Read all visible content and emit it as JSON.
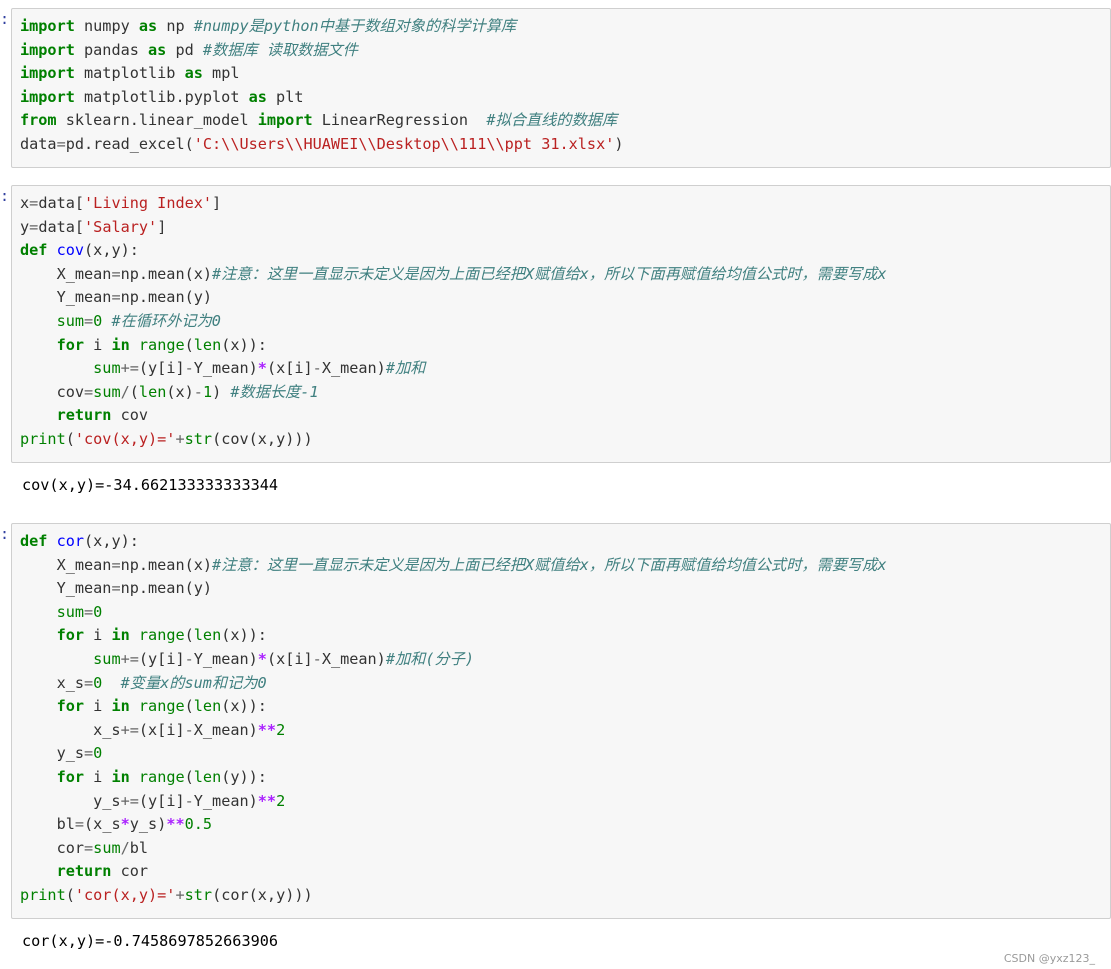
{
  "cells": [
    {
      "prompt": ":",
      "lines": [
        [
          [
            "kw",
            "import"
          ],
          [
            "t",
            " numpy "
          ],
          [
            "kw",
            "as"
          ],
          [
            "t",
            " np "
          ],
          [
            "cm",
            "#numpy是python中基于数组对象的科学计算库"
          ]
        ],
        [
          [
            "kw",
            "import"
          ],
          [
            "t",
            " pandas "
          ],
          [
            "kw",
            "as"
          ],
          [
            "t",
            " pd "
          ],
          [
            "cm",
            "#数据库 读取数据文件"
          ]
        ],
        [
          [
            "kw",
            "import"
          ],
          [
            "t",
            " matplotlib "
          ],
          [
            "kw",
            "as"
          ],
          [
            "t",
            " mpl"
          ]
        ],
        [
          [
            "kw",
            "import"
          ],
          [
            "t",
            " matplotlib.pyplot "
          ],
          [
            "kw",
            "as"
          ],
          [
            "t",
            " plt"
          ]
        ],
        [
          [
            "kw",
            "from"
          ],
          [
            "t",
            " sklearn.linear_model "
          ],
          [
            "kw",
            "import"
          ],
          [
            "t",
            " LinearRegression  "
          ],
          [
            "cm",
            "#拟合直线的数据库"
          ]
        ],
        [
          [
            "t",
            "data"
          ],
          [
            "op",
            "="
          ],
          [
            "t",
            "pd.read_excel("
          ],
          [
            "str",
            "'C:\\\\Users\\\\HUAWEI\\\\Desktop\\\\111\\\\ppt 31.xlsx'"
          ],
          [
            "t",
            ")"
          ]
        ]
      ]
    },
    {
      "prompt": ":",
      "lines": [
        [
          [
            "t",
            "x"
          ],
          [
            "op",
            "="
          ],
          [
            "t",
            "data["
          ],
          [
            "str",
            "'Living Index'"
          ],
          [
            "t",
            "]"
          ]
        ],
        [
          [
            "t",
            "y"
          ],
          [
            "op",
            "="
          ],
          [
            "t",
            "data["
          ],
          [
            "str",
            "'Salary'"
          ],
          [
            "t",
            "]"
          ]
        ],
        [
          [
            "kw",
            "def"
          ],
          [
            "t",
            " "
          ],
          [
            "fn",
            "cov"
          ],
          [
            "t",
            "(x,y):"
          ]
        ],
        [
          [
            "t",
            "    X_mean"
          ],
          [
            "op",
            "="
          ],
          [
            "t",
            "np.mean(x)"
          ],
          [
            "cm",
            "#注意：这里一直显示未定义是因为上面已经把X赋值给x，所以下面再赋值给均值公式时，需要写成x"
          ]
        ],
        [
          [
            "t",
            "    Y_mean"
          ],
          [
            "op",
            "="
          ],
          [
            "t",
            "np.mean(y)"
          ]
        ],
        [
          [
            "t",
            "    "
          ],
          [
            "bi",
            "sum"
          ],
          [
            "op",
            "="
          ],
          [
            "num",
            "0"
          ],
          [
            "t",
            " "
          ],
          [
            "cm",
            "#在循环外记为0"
          ]
        ],
        [
          [
            "t",
            "    "
          ],
          [
            "kw",
            "for"
          ],
          [
            "t",
            " i "
          ],
          [
            "kw",
            "in"
          ],
          [
            "t",
            " "
          ],
          [
            "bi",
            "range"
          ],
          [
            "t",
            "("
          ],
          [
            "bi",
            "len"
          ],
          [
            "t",
            "(x)):"
          ]
        ],
        [
          [
            "t",
            "        "
          ],
          [
            "bi",
            "sum"
          ],
          [
            "op",
            "+="
          ],
          [
            "t",
            "(y[i]"
          ],
          [
            "op",
            "-"
          ],
          [
            "t",
            "Y_mean)"
          ],
          [
            "opw",
            "*"
          ],
          [
            "t",
            "(x[i]"
          ],
          [
            "op",
            "-"
          ],
          [
            "t",
            "X_mean)"
          ],
          [
            "cm",
            "#加和"
          ]
        ],
        [
          [
            "t",
            "    cov"
          ],
          [
            "op",
            "="
          ],
          [
            "bi",
            "sum"
          ],
          [
            "op",
            "/"
          ],
          [
            "t",
            "("
          ],
          [
            "bi",
            "len"
          ],
          [
            "t",
            "(x)"
          ],
          [
            "op",
            "-"
          ],
          [
            "num",
            "1"
          ],
          [
            "t",
            ") "
          ],
          [
            "cm",
            "#数据长度-1"
          ]
        ],
        [
          [
            "t",
            "    "
          ],
          [
            "kw",
            "return"
          ],
          [
            "t",
            " cov"
          ]
        ],
        [
          [
            "bi",
            "print"
          ],
          [
            "t",
            "("
          ],
          [
            "str",
            "'cov(x,y)='"
          ],
          [
            "op",
            "+"
          ],
          [
            "bi",
            "str"
          ],
          [
            "t",
            "(cov(x,y)))"
          ]
        ]
      ],
      "output": "cov(x,y)=-34.662133333333344"
    },
    {
      "prompt": ":",
      "lines": [
        [
          [
            "kw",
            "def"
          ],
          [
            "t",
            " "
          ],
          [
            "fn",
            "cor"
          ],
          [
            "t",
            "(x,y):"
          ]
        ],
        [
          [
            "t",
            "    X_mean"
          ],
          [
            "op",
            "="
          ],
          [
            "t",
            "np.mean(x)"
          ],
          [
            "cm",
            "#注意：这里一直显示未定义是因为上面已经把X赋值给x，所以下面再赋值给均值公式时，需要写成x"
          ]
        ],
        [
          [
            "t",
            "    Y_mean"
          ],
          [
            "op",
            "="
          ],
          [
            "t",
            "np.mean(y)"
          ]
        ],
        [
          [
            "t",
            "    "
          ],
          [
            "bi",
            "sum"
          ],
          [
            "op",
            "="
          ],
          [
            "num",
            "0"
          ]
        ],
        [
          [
            "t",
            "    "
          ],
          [
            "kw",
            "for"
          ],
          [
            "t",
            " i "
          ],
          [
            "kw",
            "in"
          ],
          [
            "t",
            " "
          ],
          [
            "bi",
            "range"
          ],
          [
            "t",
            "("
          ],
          [
            "bi",
            "len"
          ],
          [
            "t",
            "(x)):"
          ]
        ],
        [
          [
            "t",
            "        "
          ],
          [
            "bi",
            "sum"
          ],
          [
            "op",
            "+="
          ],
          [
            "t",
            "(y[i]"
          ],
          [
            "op",
            "-"
          ],
          [
            "t",
            "Y_mean)"
          ],
          [
            "opw",
            "*"
          ],
          [
            "t",
            "(x[i]"
          ],
          [
            "op",
            "-"
          ],
          [
            "t",
            "X_mean)"
          ],
          [
            "cm",
            "#加和(分子)"
          ]
        ],
        [
          [
            "t",
            "    x_s"
          ],
          [
            "op",
            "="
          ],
          [
            "num",
            "0"
          ],
          [
            "t",
            "  "
          ],
          [
            "cm",
            "#变量x的sum和记为0"
          ]
        ],
        [
          [
            "t",
            "    "
          ],
          [
            "kw",
            "for"
          ],
          [
            "t",
            " i "
          ],
          [
            "kw",
            "in"
          ],
          [
            "t",
            " "
          ],
          [
            "bi",
            "range"
          ],
          [
            "t",
            "("
          ],
          [
            "bi",
            "len"
          ],
          [
            "t",
            "(x)):"
          ]
        ],
        [
          [
            "t",
            "        x_s"
          ],
          [
            "op",
            "+="
          ],
          [
            "t",
            "(x[i]"
          ],
          [
            "op",
            "-"
          ],
          [
            "t",
            "X_mean)"
          ],
          [
            "opw",
            "**"
          ],
          [
            "num",
            "2"
          ]
        ],
        [
          [
            "t",
            "    y_s"
          ],
          [
            "op",
            "="
          ],
          [
            "num",
            "0"
          ]
        ],
        [
          [
            "t",
            "    "
          ],
          [
            "kw",
            "for"
          ],
          [
            "t",
            " i "
          ],
          [
            "kw",
            "in"
          ],
          [
            "t",
            " "
          ],
          [
            "bi",
            "range"
          ],
          [
            "t",
            "("
          ],
          [
            "bi",
            "len"
          ],
          [
            "t",
            "(y)):"
          ]
        ],
        [
          [
            "t",
            "        y_s"
          ],
          [
            "op",
            "+="
          ],
          [
            "t",
            "(y[i]"
          ],
          [
            "op",
            "-"
          ],
          [
            "t",
            "Y_mean)"
          ],
          [
            "opw",
            "**"
          ],
          [
            "num",
            "2"
          ]
        ],
        [
          [
            "t",
            "    bl"
          ],
          [
            "op",
            "="
          ],
          [
            "t",
            "(x_s"
          ],
          [
            "opw",
            "*"
          ],
          [
            "t",
            "y_s)"
          ],
          [
            "opw",
            "**"
          ],
          [
            "num",
            "0.5"
          ]
        ],
        [
          [
            "t",
            "    cor"
          ],
          [
            "op",
            "="
          ],
          [
            "bi",
            "sum"
          ],
          [
            "op",
            "/"
          ],
          [
            "t",
            "bl"
          ]
        ],
        [
          [
            "t",
            "    "
          ],
          [
            "kw",
            "return"
          ],
          [
            "t",
            " cor"
          ]
        ],
        [
          [
            "bi",
            "print"
          ],
          [
            "t",
            "("
          ],
          [
            "str",
            "'cor(x,y)='"
          ],
          [
            "op",
            "+"
          ],
          [
            "bi",
            "str"
          ],
          [
            "t",
            "(cor(x,y)))"
          ]
        ]
      ],
      "output": "cor(x,y)=-0.7458697852663906"
    }
  ],
  "watermark": "CSDN @yxz123_"
}
